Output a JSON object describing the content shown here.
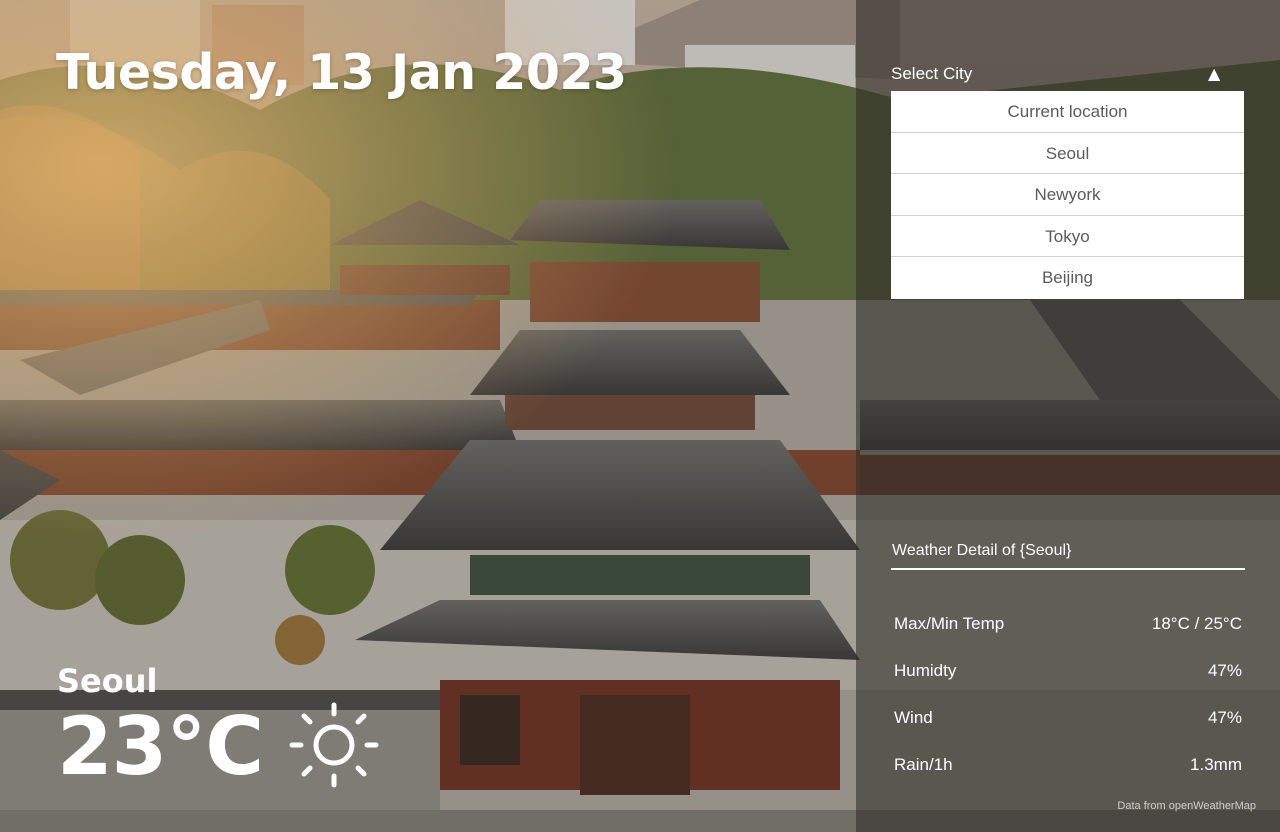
{
  "date": "Tuesday, 13 Jan 2023",
  "current": {
    "city": "Seoul",
    "temperature": "23°C",
    "condition_icon": "sun-icon"
  },
  "city_select": {
    "label": "Select City",
    "caret": "▲",
    "options": [
      "Current location",
      "Seoul",
      "Newyork",
      "Tokyo",
      "Beijing"
    ]
  },
  "detail": {
    "title": "Weather Detail of {Seoul}",
    "rows": [
      {
        "label": "Max/Min Temp",
        "value": "18°C / 25°C"
      },
      {
        "label": "Humidty",
        "value": "47%"
      },
      {
        "label": "Wind",
        "value": "47%"
      },
      {
        "label": "Rain/1h",
        "value": "1.3mm"
      }
    ]
  },
  "credit": "Data from openWeatherMap"
}
